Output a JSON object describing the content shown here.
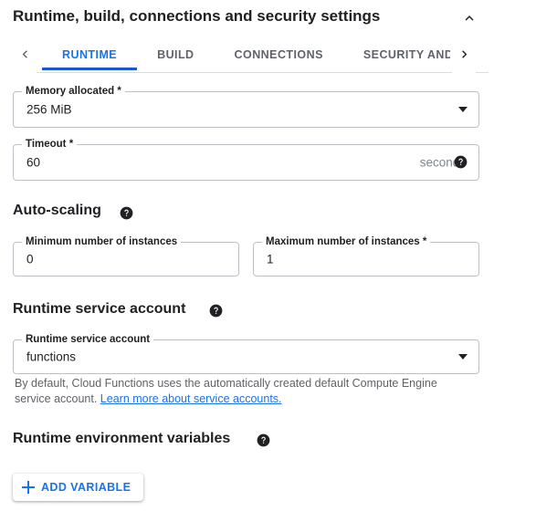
{
  "panel": {
    "title": "Runtime, build, connections and security settings",
    "collapse_icon": "chevron-up-icon"
  },
  "tabs": {
    "scroll_left_icon": "chevron-left-icon",
    "scroll_right_icon": "chevron-right-icon",
    "items": [
      {
        "label": "RUNTIME",
        "active": true
      },
      {
        "label": "BUILD",
        "active": false
      },
      {
        "label": "CONNECTIONS",
        "active": false
      },
      {
        "label": "SECURITY AND",
        "active": false
      }
    ]
  },
  "runtime": {
    "memory": {
      "label": "Memory allocated *",
      "value": "256 MiB",
      "icon": "dropdown-arrow-icon"
    },
    "timeout": {
      "label": "Timeout *",
      "value": "60",
      "suffix": "seconds",
      "help_icon": "help-icon"
    }
  },
  "autoscaling": {
    "heading": "Auto-scaling",
    "help_icon": "help-icon",
    "min_instances": {
      "label": "Minimum number of instances",
      "value": "0"
    },
    "max_instances": {
      "label": "Maximum number of instances *",
      "value": "1"
    }
  },
  "service_account": {
    "heading": "Runtime service account",
    "help_icon": "help-icon",
    "field": {
      "label": "Runtime service account",
      "value": "functions",
      "icon": "dropdown-arrow-icon"
    },
    "helper_text_before": "By default, Cloud Functions uses the automatically created default Compute Engine service account. ",
    "helper_link": "Learn more about service accounts."
  },
  "env_variables": {
    "heading": "Runtime environment variables",
    "help_icon": "help-icon",
    "add_button": {
      "label": "ADD VARIABLE",
      "icon": "plus-icon"
    }
  },
  "colors": {
    "accent": "#1a73e8",
    "indicator": "#1a56d6",
    "text_primary": "#202124",
    "text_secondary": "#5f6368",
    "border": "#bdc1c6",
    "divider": "#dadce0"
  }
}
